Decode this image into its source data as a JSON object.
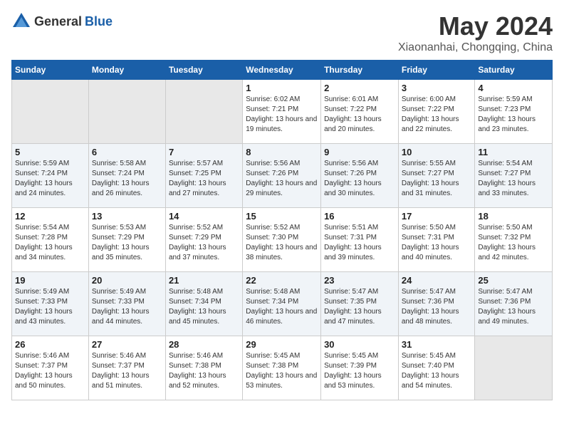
{
  "header": {
    "logo_general": "General",
    "logo_blue": "Blue",
    "month": "May 2024",
    "location": "Xiaonanhai, Chongqing, China"
  },
  "days_of_week": [
    "Sunday",
    "Monday",
    "Tuesday",
    "Wednesday",
    "Thursday",
    "Friday",
    "Saturday"
  ],
  "weeks": [
    [
      {
        "day": "",
        "sunrise": "",
        "sunset": "",
        "daylight": ""
      },
      {
        "day": "",
        "sunrise": "",
        "sunset": "",
        "daylight": ""
      },
      {
        "day": "",
        "sunrise": "",
        "sunset": "",
        "daylight": ""
      },
      {
        "day": "1",
        "sunrise": "Sunrise: 6:02 AM",
        "sunset": "Sunset: 7:21 PM",
        "daylight": "Daylight: 13 hours and 19 minutes."
      },
      {
        "day": "2",
        "sunrise": "Sunrise: 6:01 AM",
        "sunset": "Sunset: 7:22 PM",
        "daylight": "Daylight: 13 hours and 20 minutes."
      },
      {
        "day": "3",
        "sunrise": "Sunrise: 6:00 AM",
        "sunset": "Sunset: 7:22 PM",
        "daylight": "Daylight: 13 hours and 22 minutes."
      },
      {
        "day": "4",
        "sunrise": "Sunrise: 5:59 AM",
        "sunset": "Sunset: 7:23 PM",
        "daylight": "Daylight: 13 hours and 23 minutes."
      }
    ],
    [
      {
        "day": "5",
        "sunrise": "Sunrise: 5:59 AM",
        "sunset": "Sunset: 7:24 PM",
        "daylight": "Daylight: 13 hours and 24 minutes."
      },
      {
        "day": "6",
        "sunrise": "Sunrise: 5:58 AM",
        "sunset": "Sunset: 7:24 PM",
        "daylight": "Daylight: 13 hours and 26 minutes."
      },
      {
        "day": "7",
        "sunrise": "Sunrise: 5:57 AM",
        "sunset": "Sunset: 7:25 PM",
        "daylight": "Daylight: 13 hours and 27 minutes."
      },
      {
        "day": "8",
        "sunrise": "Sunrise: 5:56 AM",
        "sunset": "Sunset: 7:26 PM",
        "daylight": "Daylight: 13 hours and 29 minutes."
      },
      {
        "day": "9",
        "sunrise": "Sunrise: 5:56 AM",
        "sunset": "Sunset: 7:26 PM",
        "daylight": "Daylight: 13 hours and 30 minutes."
      },
      {
        "day": "10",
        "sunrise": "Sunrise: 5:55 AM",
        "sunset": "Sunset: 7:27 PM",
        "daylight": "Daylight: 13 hours and 31 minutes."
      },
      {
        "day": "11",
        "sunrise": "Sunrise: 5:54 AM",
        "sunset": "Sunset: 7:27 PM",
        "daylight": "Daylight: 13 hours and 33 minutes."
      }
    ],
    [
      {
        "day": "12",
        "sunrise": "Sunrise: 5:54 AM",
        "sunset": "Sunset: 7:28 PM",
        "daylight": "Daylight: 13 hours and 34 minutes."
      },
      {
        "day": "13",
        "sunrise": "Sunrise: 5:53 AM",
        "sunset": "Sunset: 7:29 PM",
        "daylight": "Daylight: 13 hours and 35 minutes."
      },
      {
        "day": "14",
        "sunrise": "Sunrise: 5:52 AM",
        "sunset": "Sunset: 7:29 PM",
        "daylight": "Daylight: 13 hours and 37 minutes."
      },
      {
        "day": "15",
        "sunrise": "Sunrise: 5:52 AM",
        "sunset": "Sunset: 7:30 PM",
        "daylight": "Daylight: 13 hours and 38 minutes."
      },
      {
        "day": "16",
        "sunrise": "Sunrise: 5:51 AM",
        "sunset": "Sunset: 7:31 PM",
        "daylight": "Daylight: 13 hours and 39 minutes."
      },
      {
        "day": "17",
        "sunrise": "Sunrise: 5:50 AM",
        "sunset": "Sunset: 7:31 PM",
        "daylight": "Daylight: 13 hours and 40 minutes."
      },
      {
        "day": "18",
        "sunrise": "Sunrise: 5:50 AM",
        "sunset": "Sunset: 7:32 PM",
        "daylight": "Daylight: 13 hours and 42 minutes."
      }
    ],
    [
      {
        "day": "19",
        "sunrise": "Sunrise: 5:49 AM",
        "sunset": "Sunset: 7:33 PM",
        "daylight": "Daylight: 13 hours and 43 minutes."
      },
      {
        "day": "20",
        "sunrise": "Sunrise: 5:49 AM",
        "sunset": "Sunset: 7:33 PM",
        "daylight": "Daylight: 13 hours and 44 minutes."
      },
      {
        "day": "21",
        "sunrise": "Sunrise: 5:48 AM",
        "sunset": "Sunset: 7:34 PM",
        "daylight": "Daylight: 13 hours and 45 minutes."
      },
      {
        "day": "22",
        "sunrise": "Sunrise: 5:48 AM",
        "sunset": "Sunset: 7:34 PM",
        "daylight": "Daylight: 13 hours and 46 minutes."
      },
      {
        "day": "23",
        "sunrise": "Sunrise: 5:47 AM",
        "sunset": "Sunset: 7:35 PM",
        "daylight": "Daylight: 13 hours and 47 minutes."
      },
      {
        "day": "24",
        "sunrise": "Sunrise: 5:47 AM",
        "sunset": "Sunset: 7:36 PM",
        "daylight": "Daylight: 13 hours and 48 minutes."
      },
      {
        "day": "25",
        "sunrise": "Sunrise: 5:47 AM",
        "sunset": "Sunset: 7:36 PM",
        "daylight": "Daylight: 13 hours and 49 minutes."
      }
    ],
    [
      {
        "day": "26",
        "sunrise": "Sunrise: 5:46 AM",
        "sunset": "Sunset: 7:37 PM",
        "daylight": "Daylight: 13 hours and 50 minutes."
      },
      {
        "day": "27",
        "sunrise": "Sunrise: 5:46 AM",
        "sunset": "Sunset: 7:37 PM",
        "daylight": "Daylight: 13 hours and 51 minutes."
      },
      {
        "day": "28",
        "sunrise": "Sunrise: 5:46 AM",
        "sunset": "Sunset: 7:38 PM",
        "daylight": "Daylight: 13 hours and 52 minutes."
      },
      {
        "day": "29",
        "sunrise": "Sunrise: 5:45 AM",
        "sunset": "Sunset: 7:38 PM",
        "daylight": "Daylight: 13 hours and 53 minutes."
      },
      {
        "day": "30",
        "sunrise": "Sunrise: 5:45 AM",
        "sunset": "Sunset: 7:39 PM",
        "daylight": "Daylight: 13 hours and 53 minutes."
      },
      {
        "day": "31",
        "sunrise": "Sunrise: 5:45 AM",
        "sunset": "Sunset: 7:40 PM",
        "daylight": "Daylight: 13 hours and 54 minutes."
      },
      {
        "day": "",
        "sunrise": "",
        "sunset": "",
        "daylight": ""
      }
    ]
  ]
}
